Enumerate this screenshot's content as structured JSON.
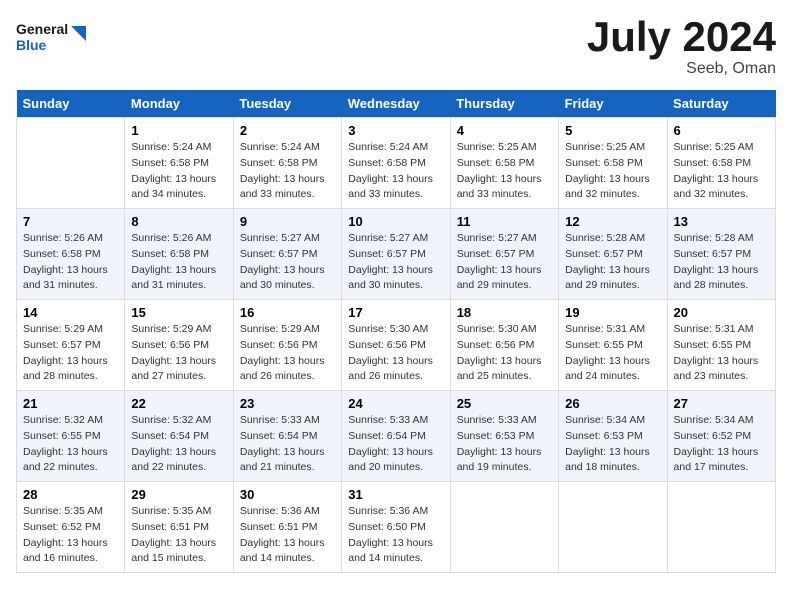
{
  "header": {
    "logo_line1": "General",
    "logo_line2": "Blue",
    "month": "July 2024",
    "location": "Seeb, Oman"
  },
  "days_of_week": [
    "Sunday",
    "Monday",
    "Tuesday",
    "Wednesday",
    "Thursday",
    "Friday",
    "Saturday"
  ],
  "weeks": [
    [
      {
        "day": "",
        "info": ""
      },
      {
        "day": "1",
        "info": "Sunrise: 5:24 AM\nSunset: 6:58 PM\nDaylight: 13 hours\nand 34 minutes."
      },
      {
        "day": "2",
        "info": "Sunrise: 5:24 AM\nSunset: 6:58 PM\nDaylight: 13 hours\nand 33 minutes."
      },
      {
        "day": "3",
        "info": "Sunrise: 5:24 AM\nSunset: 6:58 PM\nDaylight: 13 hours\nand 33 minutes."
      },
      {
        "day": "4",
        "info": "Sunrise: 5:25 AM\nSunset: 6:58 PM\nDaylight: 13 hours\nand 33 minutes."
      },
      {
        "day": "5",
        "info": "Sunrise: 5:25 AM\nSunset: 6:58 PM\nDaylight: 13 hours\nand 32 minutes."
      },
      {
        "day": "6",
        "info": "Sunrise: 5:25 AM\nSunset: 6:58 PM\nDaylight: 13 hours\nand 32 minutes."
      }
    ],
    [
      {
        "day": "7",
        "info": "Sunrise: 5:26 AM\nSunset: 6:58 PM\nDaylight: 13 hours\nand 31 minutes."
      },
      {
        "day": "8",
        "info": "Sunrise: 5:26 AM\nSunset: 6:58 PM\nDaylight: 13 hours\nand 31 minutes."
      },
      {
        "day": "9",
        "info": "Sunrise: 5:27 AM\nSunset: 6:57 PM\nDaylight: 13 hours\nand 30 minutes."
      },
      {
        "day": "10",
        "info": "Sunrise: 5:27 AM\nSunset: 6:57 PM\nDaylight: 13 hours\nand 30 minutes."
      },
      {
        "day": "11",
        "info": "Sunrise: 5:27 AM\nSunset: 6:57 PM\nDaylight: 13 hours\nand 29 minutes."
      },
      {
        "day": "12",
        "info": "Sunrise: 5:28 AM\nSunset: 6:57 PM\nDaylight: 13 hours\nand 29 minutes."
      },
      {
        "day": "13",
        "info": "Sunrise: 5:28 AM\nSunset: 6:57 PM\nDaylight: 13 hours\nand 28 minutes."
      }
    ],
    [
      {
        "day": "14",
        "info": "Sunrise: 5:29 AM\nSunset: 6:57 PM\nDaylight: 13 hours\nand 28 minutes."
      },
      {
        "day": "15",
        "info": "Sunrise: 5:29 AM\nSunset: 6:56 PM\nDaylight: 13 hours\nand 27 minutes."
      },
      {
        "day": "16",
        "info": "Sunrise: 5:29 AM\nSunset: 6:56 PM\nDaylight: 13 hours\nand 26 minutes."
      },
      {
        "day": "17",
        "info": "Sunrise: 5:30 AM\nSunset: 6:56 PM\nDaylight: 13 hours\nand 26 minutes."
      },
      {
        "day": "18",
        "info": "Sunrise: 5:30 AM\nSunset: 6:56 PM\nDaylight: 13 hours\nand 25 minutes."
      },
      {
        "day": "19",
        "info": "Sunrise: 5:31 AM\nSunset: 6:55 PM\nDaylight: 13 hours\nand 24 minutes."
      },
      {
        "day": "20",
        "info": "Sunrise: 5:31 AM\nSunset: 6:55 PM\nDaylight: 13 hours\nand 23 minutes."
      }
    ],
    [
      {
        "day": "21",
        "info": "Sunrise: 5:32 AM\nSunset: 6:55 PM\nDaylight: 13 hours\nand 22 minutes."
      },
      {
        "day": "22",
        "info": "Sunrise: 5:32 AM\nSunset: 6:54 PM\nDaylight: 13 hours\nand 22 minutes."
      },
      {
        "day": "23",
        "info": "Sunrise: 5:33 AM\nSunset: 6:54 PM\nDaylight: 13 hours\nand 21 minutes."
      },
      {
        "day": "24",
        "info": "Sunrise: 5:33 AM\nSunset: 6:54 PM\nDaylight: 13 hours\nand 20 minutes."
      },
      {
        "day": "25",
        "info": "Sunrise: 5:33 AM\nSunset: 6:53 PM\nDaylight: 13 hours\nand 19 minutes."
      },
      {
        "day": "26",
        "info": "Sunrise: 5:34 AM\nSunset: 6:53 PM\nDaylight: 13 hours\nand 18 minutes."
      },
      {
        "day": "27",
        "info": "Sunrise: 5:34 AM\nSunset: 6:52 PM\nDaylight: 13 hours\nand 17 minutes."
      }
    ],
    [
      {
        "day": "28",
        "info": "Sunrise: 5:35 AM\nSunset: 6:52 PM\nDaylight: 13 hours\nand 16 minutes."
      },
      {
        "day": "29",
        "info": "Sunrise: 5:35 AM\nSunset: 6:51 PM\nDaylight: 13 hours\nand 15 minutes."
      },
      {
        "day": "30",
        "info": "Sunrise: 5:36 AM\nSunset: 6:51 PM\nDaylight: 13 hours\nand 14 minutes."
      },
      {
        "day": "31",
        "info": "Sunrise: 5:36 AM\nSunset: 6:50 PM\nDaylight: 13 hours\nand 14 minutes."
      },
      {
        "day": "",
        "info": ""
      },
      {
        "day": "",
        "info": ""
      },
      {
        "day": "",
        "info": ""
      }
    ]
  ]
}
